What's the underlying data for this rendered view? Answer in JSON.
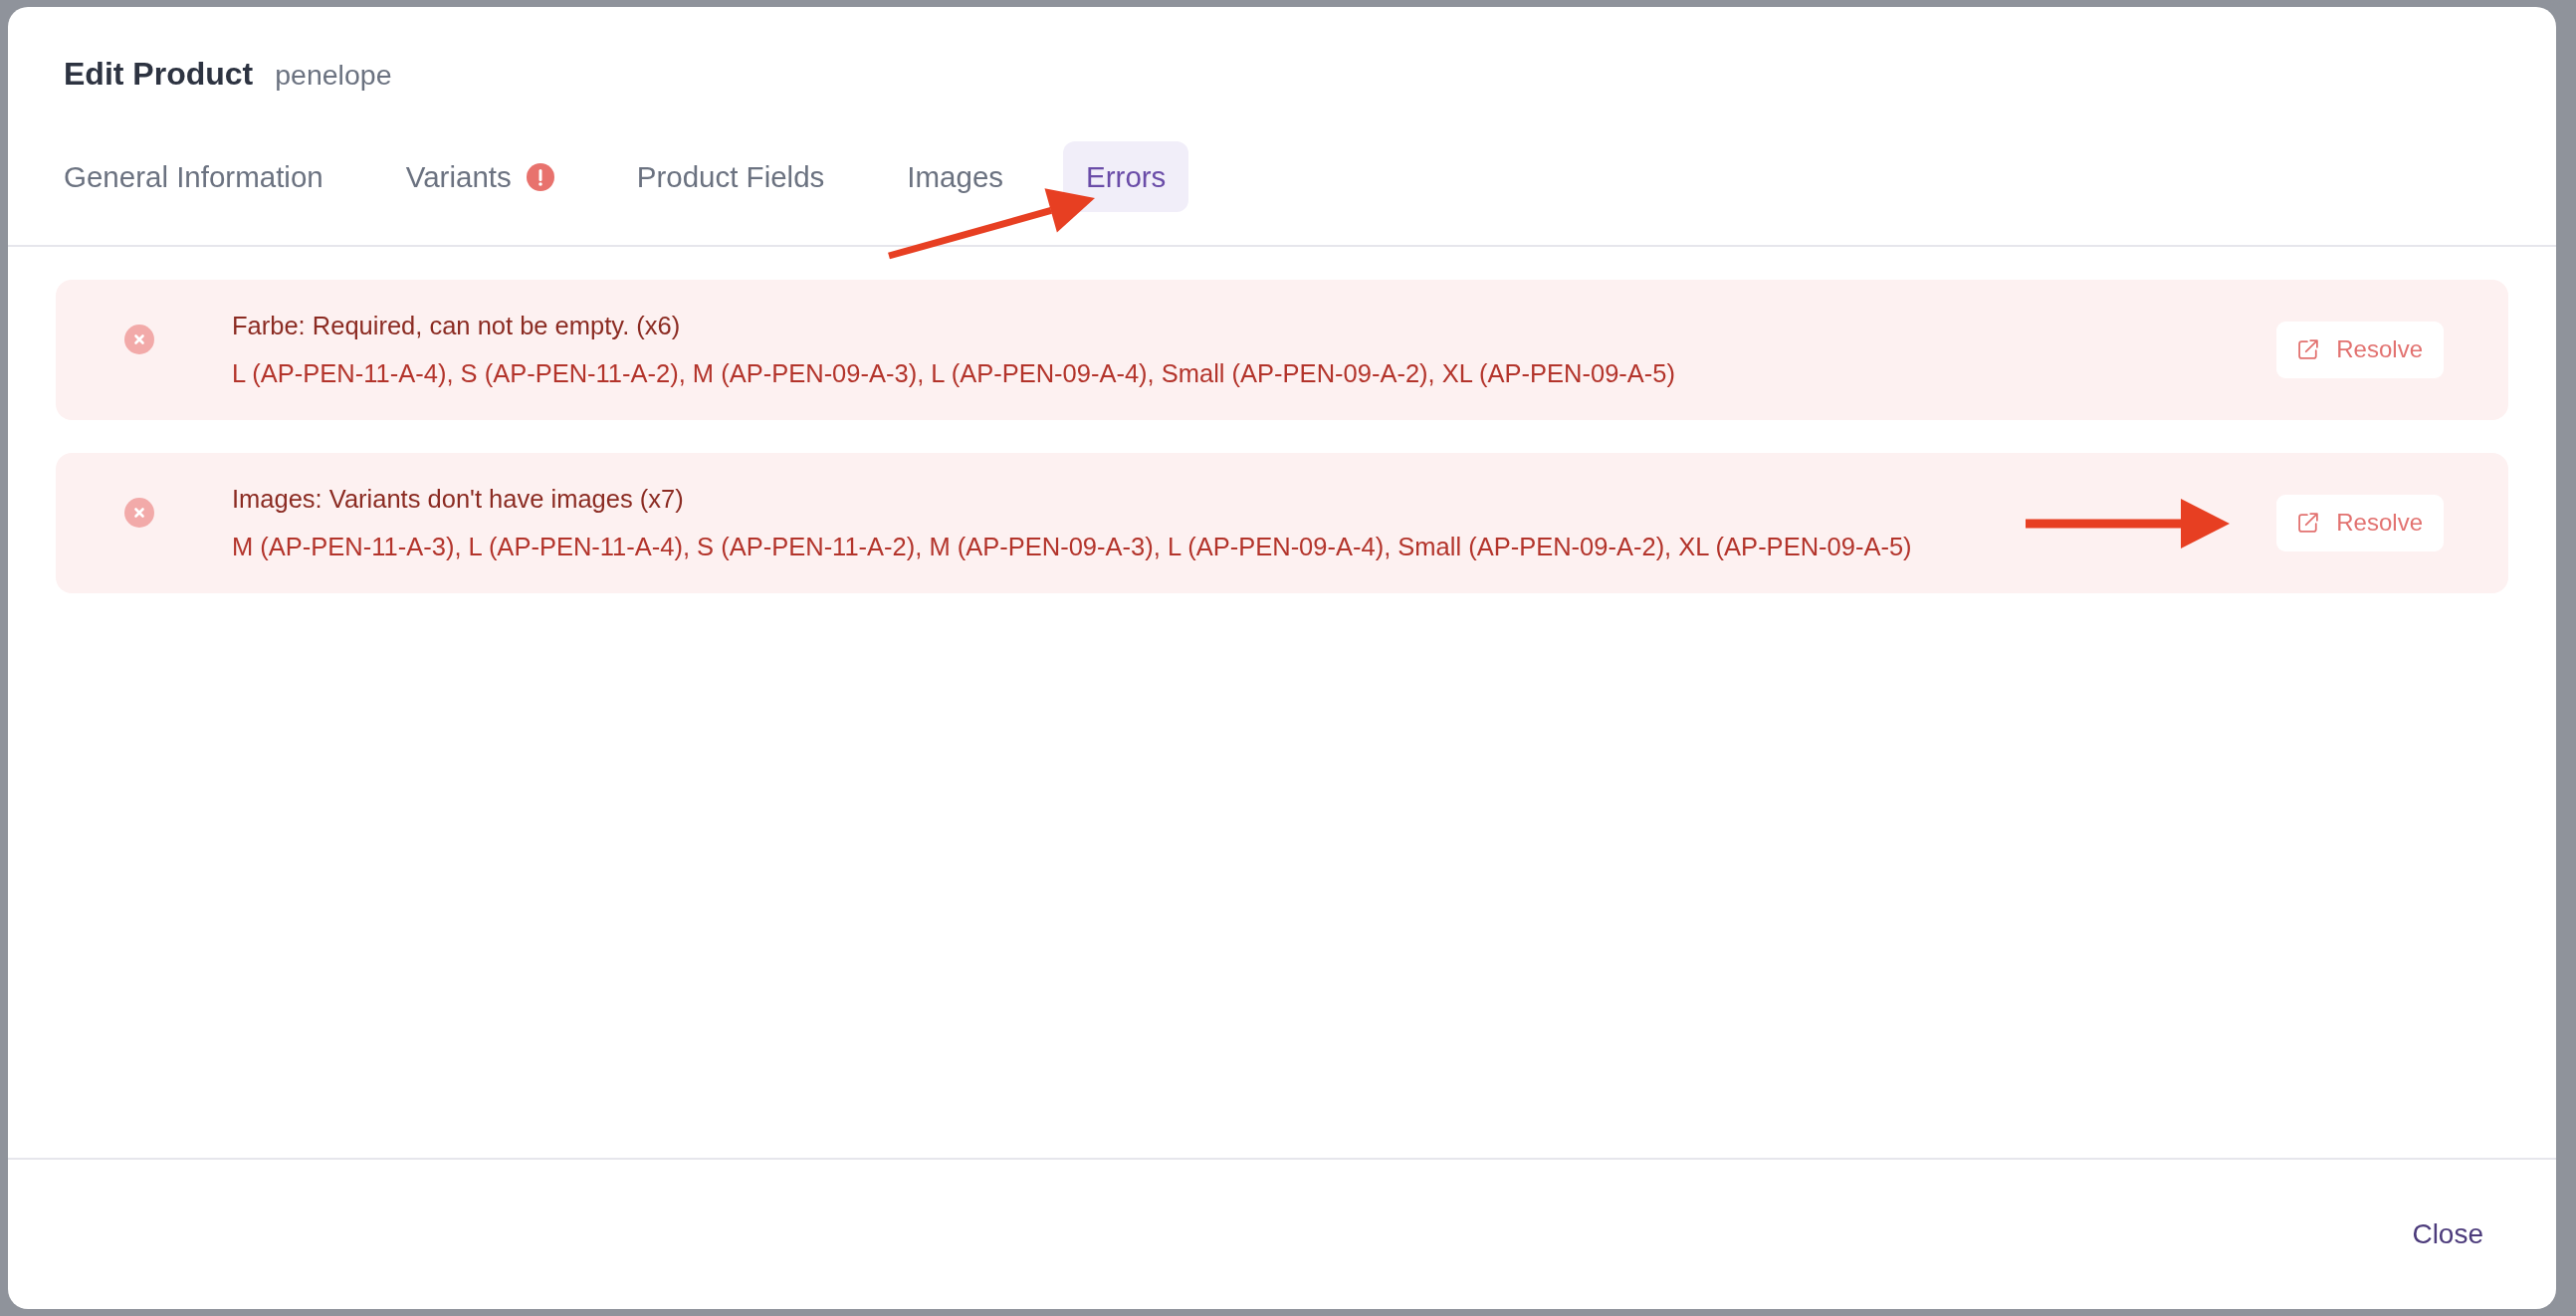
{
  "dialog": {
    "title": "Edit Product",
    "subtitle": "penelope"
  },
  "tabs": [
    {
      "label": "General Information",
      "selected": false,
      "has_error": false
    },
    {
      "label": "Variants",
      "selected": false,
      "has_error": true
    },
    {
      "label": "Product Fields",
      "selected": false,
      "has_error": false
    },
    {
      "label": "Images",
      "selected": false,
      "has_error": false
    },
    {
      "label": "Errors",
      "selected": true,
      "has_error": false
    }
  ],
  "errors": [
    {
      "title": "Farbe: Required, can not be empty. (x6)",
      "details": "L (AP-PEN-11-A-4), S (AP-PEN-11-A-2), M (AP-PEN-09-A-3), L (AP-PEN-09-A-4), Small (AP-PEN-09-A-2), XL (AP-PEN-09-A-5)",
      "action": "Resolve"
    },
    {
      "title": "Images: Variants don't have images (x7)",
      "details": "M (AP-PEN-11-A-3), L (AP-PEN-11-A-4), S (AP-PEN-11-A-2), M (AP-PEN-09-A-3), L (AP-PEN-09-A-4), Small (AP-PEN-09-A-2), XL (AP-PEN-09-A-5)",
      "action": "Resolve"
    }
  ],
  "footer": {
    "close": "Close"
  }
}
